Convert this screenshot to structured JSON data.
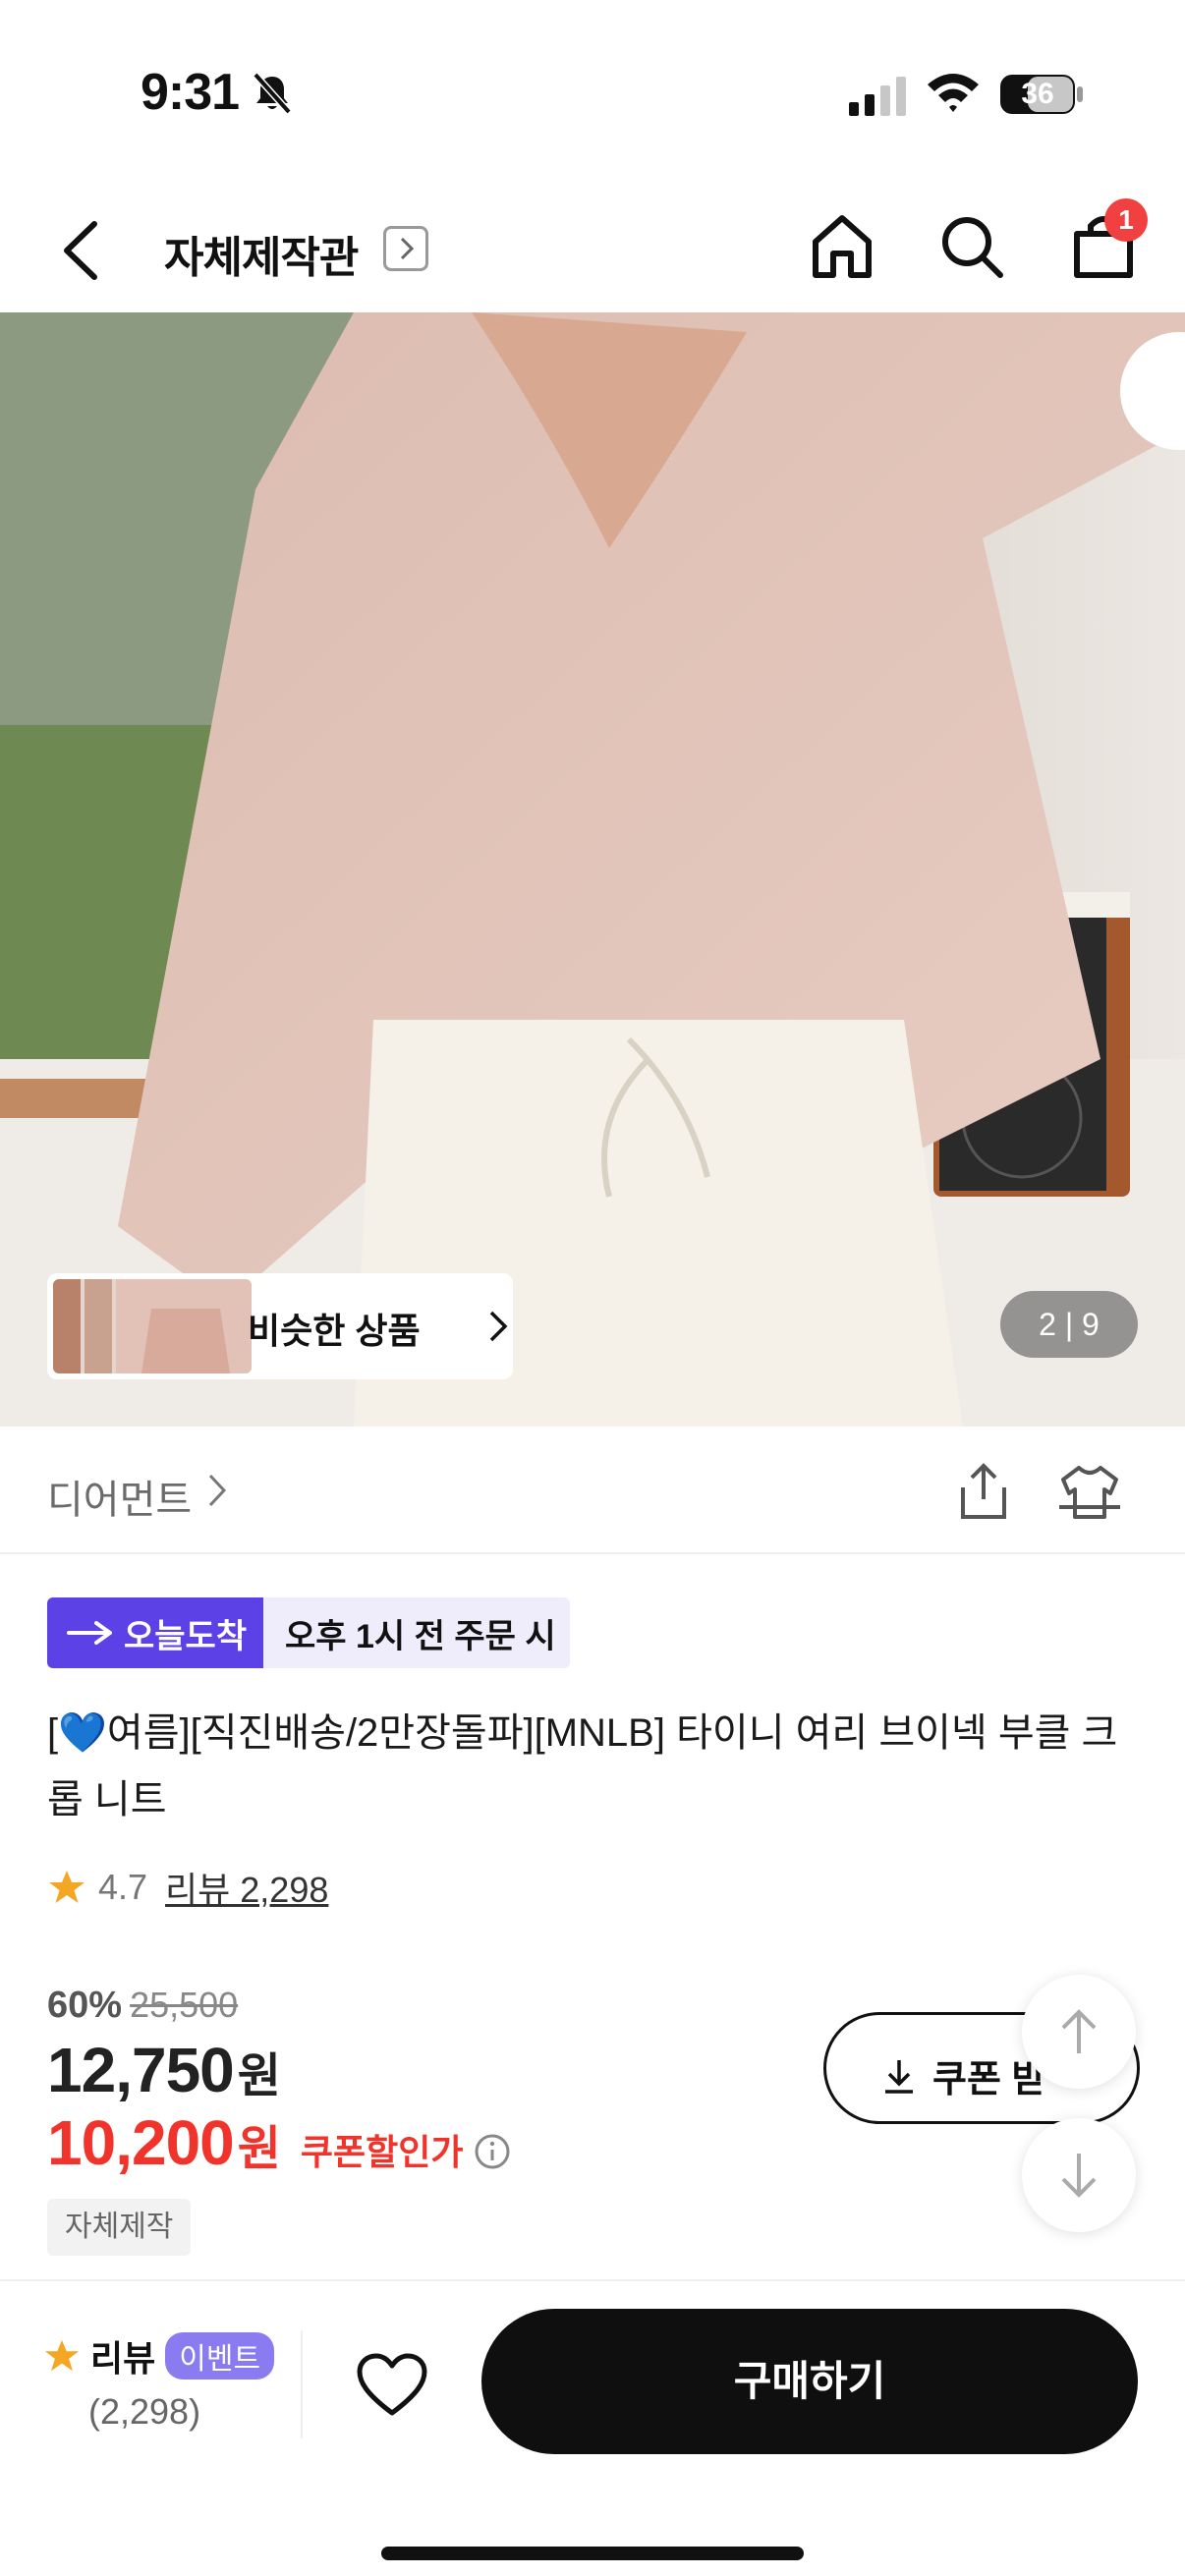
{
  "status": {
    "time": "9:31",
    "battery": "36"
  },
  "nav": {
    "title": "자체제작관",
    "cart_count": "1"
  },
  "hero": {
    "similar_label": "비슷한 상품",
    "page_indicator": "2 | 9"
  },
  "brand": {
    "name": "디어먼트"
  },
  "delivery": {
    "badge": "오늘도착",
    "note": "오후 1시 전 주문 시"
  },
  "product": {
    "title": "[💙여름][직진배송/2만장돌파][MNLB] 타이니 여리 브이넥 부클 크롭 니트",
    "rating": "4.7",
    "review_link": "리뷰 2,298"
  },
  "price": {
    "discount_pct": "60%",
    "original": "25,500",
    "sale": "12,750",
    "sale_unit": "원",
    "coupon_price": "10,200",
    "coupon_unit": "원",
    "coupon_label": "쿠폰할인가",
    "tag": "자체제작",
    "coupon_button": "쿠폰 받"
  },
  "bottom": {
    "review_label": "리뷰",
    "event_badge": "이벤트",
    "review_count": "(2,298)",
    "buy_label": "구매하기"
  },
  "colors": {
    "accent_purple": "#5b41e6",
    "sale_red": "#f0342b",
    "star": "#f5a623"
  }
}
